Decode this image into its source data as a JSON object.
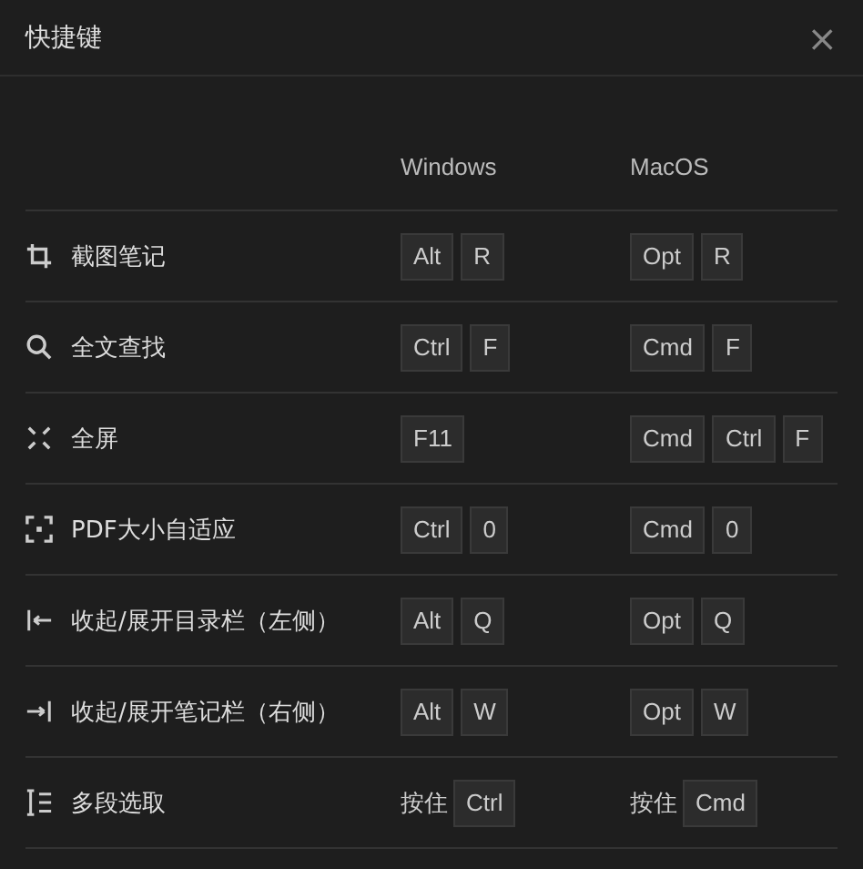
{
  "window": {
    "title": "快捷键",
    "close": "×"
  },
  "columns": [
    "Windows",
    "MacOS"
  ],
  "shortcuts": [
    {
      "label": "截图笔记",
      "windows": {
        "keys": [
          "Alt",
          "R"
        ]
      },
      "macos": {
        "keys": [
          "Opt",
          "R"
        ]
      }
    },
    {
      "label": "全文查找",
      "windows": {
        "keys": [
          "Ctrl",
          "F"
        ]
      },
      "macos": {
        "keys": [
          "Cmd",
          "F"
        ]
      }
    },
    {
      "label": "全屏",
      "windows": {
        "keys": [
          "F11"
        ]
      },
      "macos": {
        "keys": [
          "Cmd",
          "Ctrl",
          "F"
        ]
      }
    },
    {
      "label": "PDF大小自适应",
      "windows": {
        "keys": [
          "Ctrl",
          "0"
        ]
      },
      "macos": {
        "keys": [
          "Cmd",
          "0"
        ]
      }
    },
    {
      "label": "收起/展开目录栏（左侧）",
      "windows": {
        "keys": [
          "Alt",
          "Q"
        ]
      },
      "macos": {
        "keys": [
          "Opt",
          "Q"
        ]
      }
    },
    {
      "label": "收起/展开笔记栏（右侧）",
      "windows": {
        "keys": [
          "Alt",
          "W"
        ]
      },
      "macos": {
        "keys": [
          "Opt",
          "W"
        ]
      }
    },
    {
      "label": "多段选取",
      "windows": {
        "prefix": "按住",
        "keys": [
          "Ctrl"
        ]
      },
      "macos": {
        "prefix": "按住",
        "keys": [
          "Cmd"
        ]
      }
    }
  ]
}
